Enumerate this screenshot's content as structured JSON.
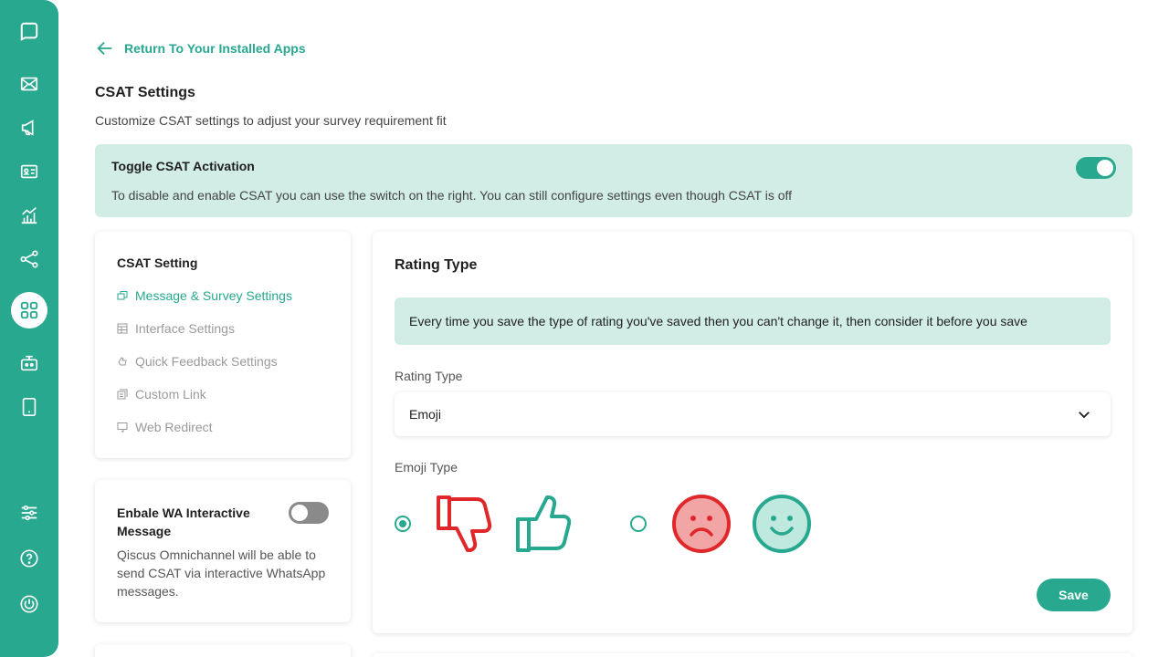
{
  "sidebar": {
    "items": [
      {
        "icon": "chat-logo-icon"
      },
      {
        "icon": "inbox-icon"
      },
      {
        "icon": "megaphone-icon"
      },
      {
        "icon": "contact-card-icon"
      },
      {
        "icon": "analytics-icon"
      },
      {
        "icon": "integration-icon"
      },
      {
        "icon": "apps-grid-icon",
        "active": true
      },
      {
        "icon": "bot-icon"
      },
      {
        "icon": "mobile-icon"
      },
      {
        "icon": "settings-sliders-icon"
      },
      {
        "icon": "help-icon"
      },
      {
        "icon": "power-icon"
      }
    ]
  },
  "nav": {
    "back_label": "Return To Your Installed Apps"
  },
  "page": {
    "title": "CSAT Settings",
    "subtitle": "Customize CSAT settings to adjust your survey requirement fit"
  },
  "activation": {
    "title": "Toggle CSAT Activation",
    "description": "To disable and enable CSAT you can use the switch on the right. You can still configure settings even though CSAT is off",
    "enabled": true
  },
  "settings_menu": {
    "title": "CSAT Setting",
    "items": [
      {
        "label": "Message & Survey Settings",
        "active": true
      },
      {
        "label": "Interface Settings"
      },
      {
        "label": "Quick Feedback Settings"
      },
      {
        "label": "Custom Link"
      },
      {
        "label": "Web Redirect"
      }
    ]
  },
  "wa_card": {
    "title": "Enbale WA Interactive Message",
    "description": "Qiscus Omnichannel will be able to send CSAT via interactive WhatsApp messages.",
    "enabled": false
  },
  "rating": {
    "title": "Rating Type",
    "notice": "Every time you save the type of rating you've saved then you can't change it, then consider it before you save",
    "rating_type_label": "Rating Type",
    "rating_type_value": "Emoji",
    "emoji_type_label": "Emoji Type",
    "emoji_options": [
      {
        "icons": [
          "thumbs-down-icon",
          "thumbs-up-icon"
        ],
        "selected": true
      },
      {
        "icons": [
          "sad-face-icon",
          "happy-face-icon"
        ],
        "selected": false
      }
    ],
    "save_label": "Save"
  },
  "colors": {
    "accent": "#27a88f",
    "banner_bg": "#d2ede5",
    "negative": "#e0282b",
    "negative_fill": "#f2a5a5",
    "positive_fill": "#bfe8de"
  }
}
